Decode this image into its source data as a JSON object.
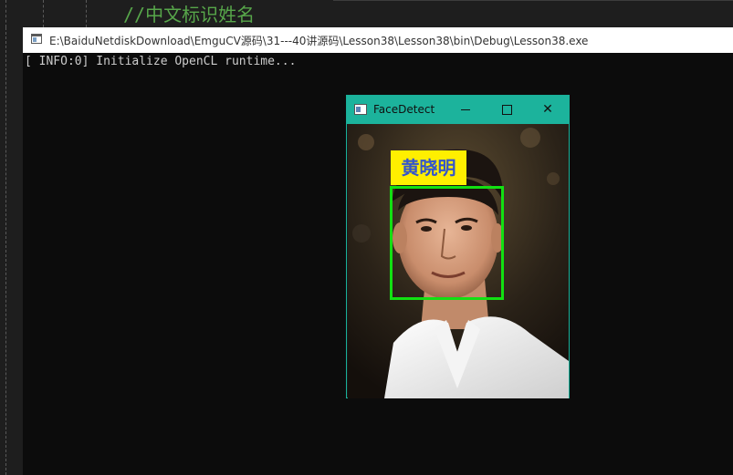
{
  "ide": {
    "code_comment": "//中文标识姓名"
  },
  "console": {
    "title": "E:\\BaiduNetdiskDownload\\EmguCV源码\\31---40讲源码\\Lesson38\\Lesson38\\bin\\Debug\\Lesson38.exe",
    "output_line": "[ INFO:0] Initialize OpenCL runtime..."
  },
  "facedetect": {
    "title": "FaceDetect",
    "minimize_label": "",
    "maximize_label": "",
    "close_label": "✕",
    "name_label": "黄晓明",
    "box_color": "#12e012",
    "label_bg": "#ffef00",
    "titlebar_color": "#1cb39c"
  }
}
